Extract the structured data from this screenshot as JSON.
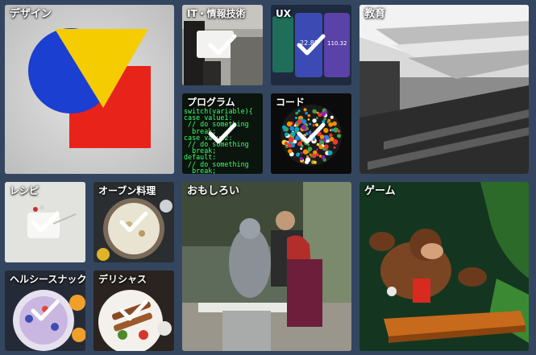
{
  "categories": [
    {
      "label": "デザイン",
      "selected": false
    },
    {
      "label": "IT・情報技術",
      "selected": true
    },
    {
      "label": "UX",
      "selected": true
    },
    {
      "label": "教育",
      "selected": false
    },
    {
      "label": "プログラム",
      "selected": true
    },
    {
      "label": "コード",
      "selected": true
    },
    {
      "label": "レシピ",
      "selected": true
    },
    {
      "label": "オーブン料理",
      "selected": true
    },
    {
      "label": "おもしろい",
      "selected": false
    },
    {
      "label": "ゲーム",
      "selected": false
    },
    {
      "label": "ヘルシースナック",
      "selected": true
    },
    {
      "label": "デリシャス",
      "selected": true
    }
  ],
  "code_lines": [
    "switch(variable){",
    "case value1:",
    " // do something",
    "  break;",
    "case value2:",
    " // do something",
    "  break;",
    "default:",
    " // do something",
    "  break;"
  ],
  "ux_screen_values": [
    "22.85",
    "110.32"
  ],
  "colors": {
    "background": "#34465f",
    "check": "#ffffff",
    "design_blue": "#1b3fd0",
    "design_yellow": "#f5cc00",
    "design_red": "#e8231a",
    "code_green": "#3cff6a"
  }
}
